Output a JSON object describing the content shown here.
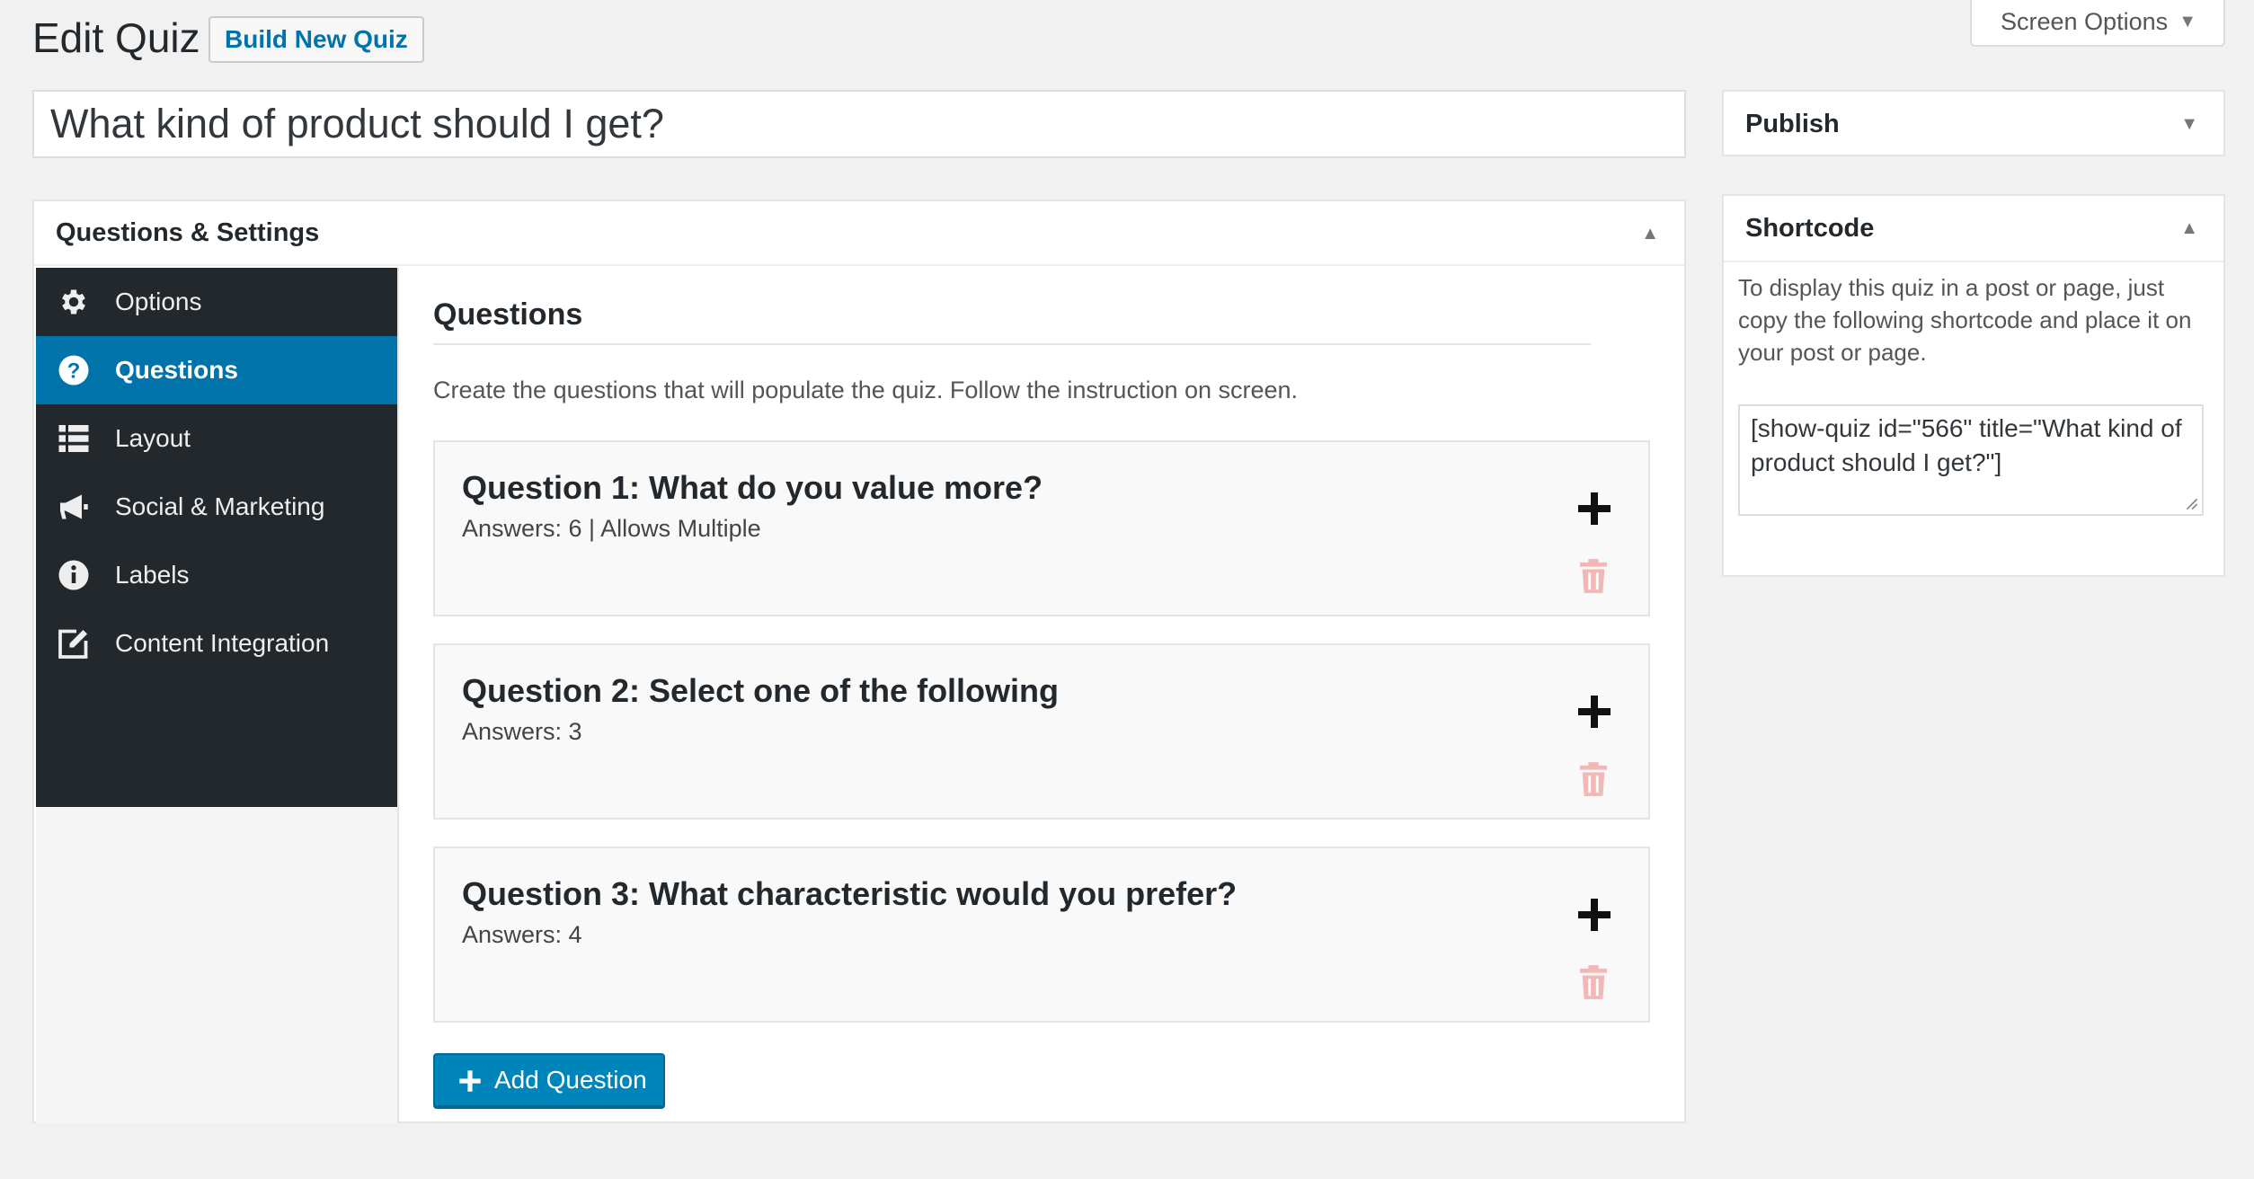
{
  "header": {
    "title": "Edit Quiz",
    "build_new_label": "Build New Quiz",
    "screen_options_label": "Screen Options"
  },
  "quiz_title": "What kind of product should I get?",
  "main_box": {
    "title": "Questions & Settings",
    "nav": [
      {
        "label": "Options",
        "icon": "gear-icon",
        "active": false
      },
      {
        "label": "Questions",
        "icon": "question-circle-icon",
        "active": true
      },
      {
        "label": "Layout",
        "icon": "list-icon",
        "active": false
      },
      {
        "label": "Social & Marketing",
        "icon": "megaphone-icon",
        "active": false
      },
      {
        "label": "Labels",
        "icon": "info-icon",
        "active": false
      },
      {
        "label": "Content Integration",
        "icon": "edit-icon",
        "active": false
      }
    ],
    "content": {
      "title": "Questions",
      "description": "Create the questions that will populate the quiz. Follow the instruction on screen.",
      "questions": [
        {
          "title": "Question 1: What do you value more?",
          "meta": "Answers: 6 | Allows Multiple"
        },
        {
          "title": "Question 2: Select one of the following",
          "meta": "Answers: 3"
        },
        {
          "title": "Question 3: What characteristic would you prefer?",
          "meta": "Answers: 4"
        }
      ],
      "add_question_label": "Add Question"
    }
  },
  "publish": {
    "title": "Publish"
  },
  "shortcode": {
    "title": "Shortcode",
    "description": "To display this quiz in a post or page, just copy the following shortcode and place it on your post or page.",
    "value": "[show-quiz id=\"566\" title=\"What kind of product should I get?\"]"
  },
  "colors": {
    "accent": "#0073aa",
    "sidebar_bg": "#23282d",
    "button_blue": "#0085ba",
    "delete_icon": "#f2b8b8"
  }
}
